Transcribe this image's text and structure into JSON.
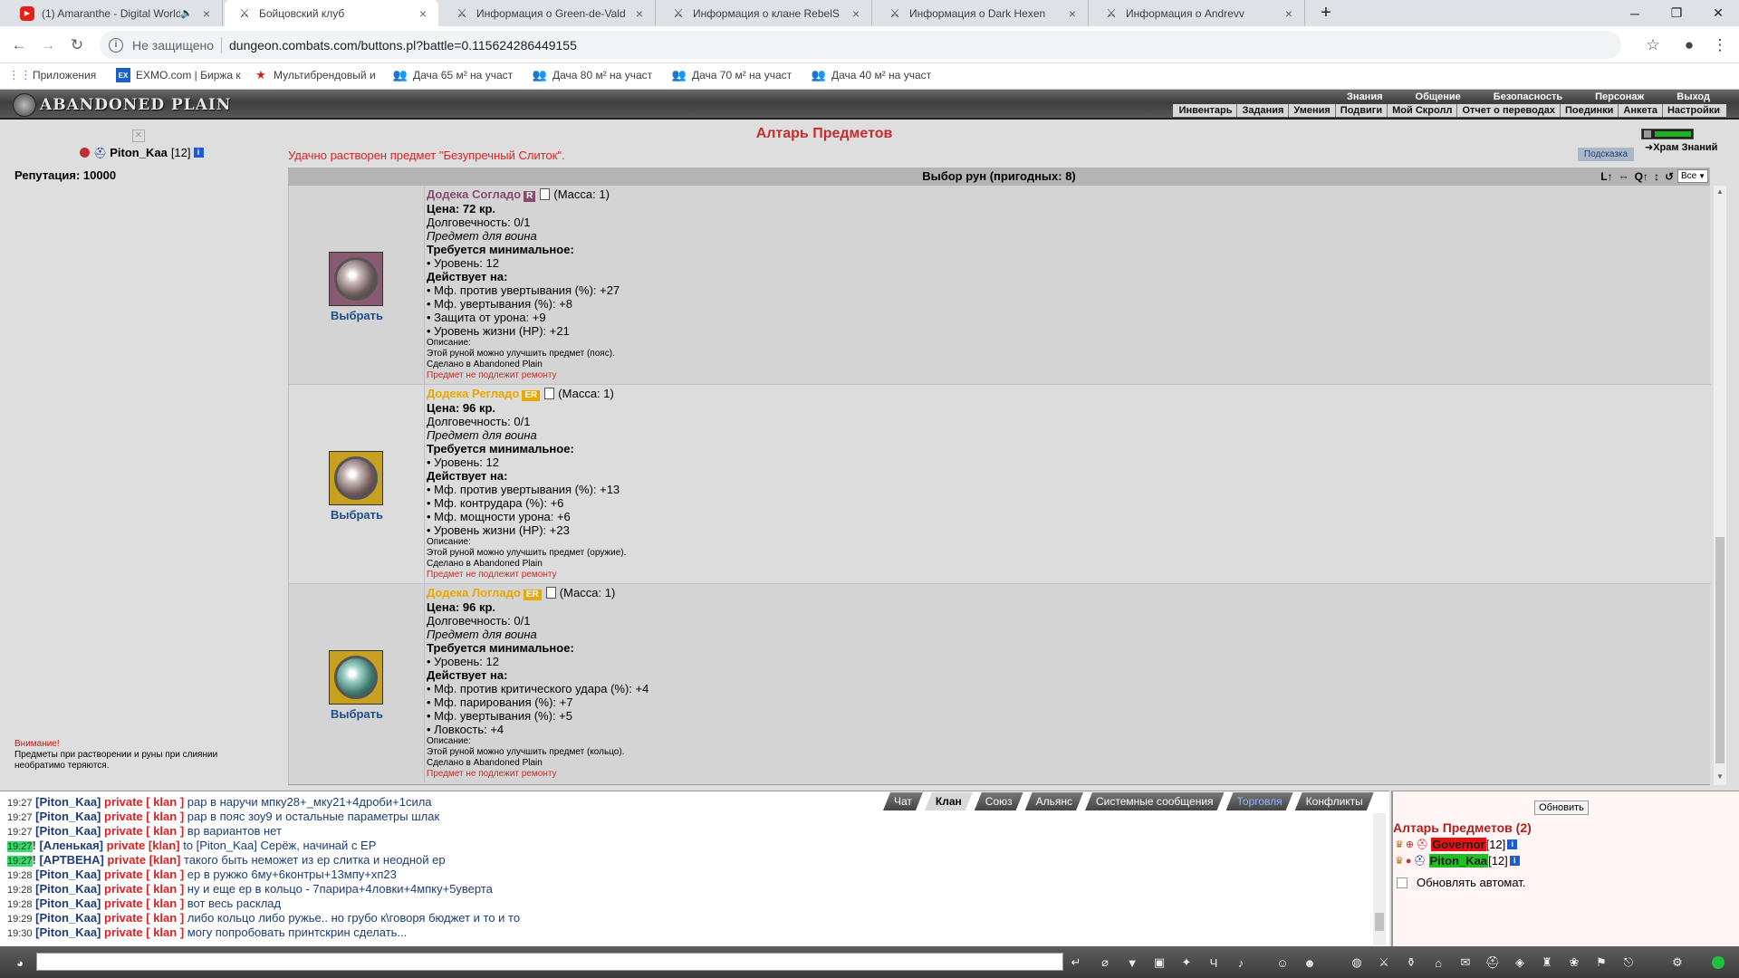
{
  "browser": {
    "tabs": [
      {
        "title": "(1) Amaranthe - Digital World",
        "icon": "youtube-icon",
        "active": false
      },
      {
        "title": "Бойцовский клуб",
        "icon": "swords-icon",
        "active": true
      },
      {
        "title": "Информация о Green-de-Vald",
        "icon": "swords-icon",
        "active": false
      },
      {
        "title": "Информация о клане RebelS",
        "icon": "swords-icon",
        "active": false
      },
      {
        "title": "Информация о Dark Hexen",
        "icon": "swords-icon",
        "active": false
      },
      {
        "title": "Информация о Andrevv",
        "icon": "swords-icon",
        "active": false
      }
    ],
    "security_label": "Не защищено",
    "url": "dungeon.combats.com/buttons.pl?battle=0.115624286449155",
    "bookmarks": [
      {
        "label": "Приложения",
        "icon": "apps-grid-icon"
      },
      {
        "label": "EXMO.com | Биржа к",
        "icon": "exmo-icon"
      },
      {
        "label": "Мультибрендовый и",
        "icon": "star-icon"
      },
      {
        "label": "Дача 65 м² на участ",
        "icon": "people-icon"
      },
      {
        "label": "Дача 80 м² на участ",
        "icon": "people-icon"
      },
      {
        "label": "Дача 70 м² на участ",
        "icon": "people-icon"
      },
      {
        "label": "Дача 40 м² на участ",
        "icon": "people-icon"
      }
    ]
  },
  "game": {
    "logo": "ABANDONED PLAIN",
    "top_menu": [
      "Знания",
      "Общение",
      "Безопасность",
      "Персонаж",
      "Выход"
    ],
    "sub_menu": [
      "Инвентарь",
      "Задания",
      "Умения",
      "Подвиги",
      "Мой Скролл",
      "Отчет о переводах",
      "Поединки",
      "Анкета",
      "Настройки"
    ]
  },
  "player": {
    "name": "Piton_Kaa",
    "level": "[12]",
    "reputation": "Репутация: 10000",
    "warning_title": "Внимание!",
    "warning_text": "Предметы при растворении и руны при слиянии необратимо теряются."
  },
  "main": {
    "title": "Алтарь Предметов",
    "success": "Удачно растворен предмет \"Безупречный Слиток\".",
    "hint_button": "Подсказка",
    "temple_link": "Храм Знаний",
    "list_header": "Выбор рун (пригодных: 8)",
    "filter_value": "Все",
    "sort_icons": [
      "L↑",
      "⇔",
      "Q↑",
      "↕",
      "↺"
    ],
    "pick_label": "Выбрать",
    "items": [
      {
        "name": "Додека Согладо",
        "tag": "R",
        "tag_color": "#8a4a70",
        "name_color": "#8a4a70",
        "mass": "(Масса: 1)",
        "price": "Цена: 72 кр.",
        "durability": "Долговечность: 0/1",
        "for_whom": "Предмет для воина",
        "req_title": "Требуется минимальное:",
        "requirements": [
          "• Уровень: 12"
        ],
        "effects_title": "Действует на:",
        "effects": [
          "• Мф. против увертывания (%): +27",
          "• Мф. увертывания (%): +8",
          "• Защита от урона: +9",
          "• Уровень жизни (HP): +21"
        ],
        "desc_title": "Описание:",
        "desc": "Этой руной можно улучшить предмет (пояс).",
        "made": "Сделано в Abandoned Plain",
        "norepair": "Предмет не подлежит ремонту",
        "rune_color": "#8a5a70"
      },
      {
        "name": "Додека Регладо",
        "tag": "ER",
        "tag_color": "#e8a800",
        "name_color": "#e8a800",
        "mass": "(Масса: 1)",
        "price": "Цена: 96 кр.",
        "durability": "Долговечность: 0/1",
        "for_whom": "Предмет для воина",
        "req_title": "Требуется минимальное:",
        "requirements": [
          "• Уровень: 12"
        ],
        "effects_title": "Действует на:",
        "effects": [
          "• Мф. против увертывания (%): +13",
          "• Мф. контрудара (%): +6",
          "• Мф. мощности урона: +6",
          "• Уровень жизни (HP): +23"
        ],
        "desc_title": "Описание:",
        "desc": "Этой руной можно улучшить предмет (оружие).",
        "made": "Сделано в Abandoned Plain",
        "norepair": "Предмет не подлежит ремонту",
        "rune_color": "#c8a020"
      },
      {
        "name": "Додека Логладо",
        "tag": "ER",
        "tag_color": "#e8a800",
        "name_color": "#e8a800",
        "mass": "(Масса: 1)",
        "price": "Цена: 96 кр.",
        "durability": "Долговечность: 0/1",
        "for_whom": "Предмет для воина",
        "req_title": "Требуется минимальное:",
        "requirements": [
          "• Уровень: 12"
        ],
        "effects_title": "Действует на:",
        "effects": [
          "• Мф. против критического удара (%): +4",
          "• Мф. парирования (%): +7",
          "• Мф. увертывания (%): +5",
          "• Ловкость: +4"
        ],
        "desc_title": "Описание:",
        "desc": "Этой руной можно улучшить предмет (кольцо).",
        "made": "Сделано в Abandoned Plain",
        "norepair": "Предмет не подлежит ремонту",
        "rune_color": "#c8a020"
      }
    ]
  },
  "chat": {
    "tabs": [
      "Чат",
      "Клан",
      "Союз",
      "Альянс",
      "Системные сообщения",
      "Торговля",
      "Конфликты"
    ],
    "lines": [
      {
        "time": "19:27",
        "nick": "[Piton_Kaa]",
        "priv": "private [ klan ]",
        "msg": "рар в наручи мпку28+_мку21+4дроби+1сила",
        "hl": false
      },
      {
        "time": "19:27",
        "nick": "[Piton_Kaa]",
        "priv": "private [ klan ]",
        "msg": "рар в пояс зоу9 и остальные параметры шлак",
        "hl": false
      },
      {
        "time": "19:27",
        "nick": "[Piton_Kaa]",
        "priv": "private [ klan ]",
        "msg": "вр вариантов нет",
        "hl": false
      },
      {
        "time": "19:27",
        "nick": "! [Аленькая]",
        "priv": "private [klan]",
        "msg": "to [Piton_Kaa] Серёж, начинай с ЕР",
        "hl": true
      },
      {
        "time": "19:27",
        "nick": "! [АРТВЕНА]",
        "priv": "private [klan]",
        "msg": "такого быть неможет из ер слитка и неодной ер",
        "hl": true
      },
      {
        "time": "19:28",
        "nick": "[Piton_Kaa]",
        "priv": "private [ klan ]",
        "msg": "ер в ружжо 6му+6контры+13мпу+хп23",
        "hl": false
      },
      {
        "time": "19:28",
        "nick": "[Piton_Kaa]",
        "priv": "private [ klan ]",
        "msg": "ну и еще ер в кольцо - 7парира+4ловки+4мпку+5уверта",
        "hl": false
      },
      {
        "time": "19:28",
        "nick": "[Piton_Kaa]",
        "priv": "private [ klan ]",
        "msg": "вот весь расклад",
        "hl": false
      },
      {
        "time": "19:29",
        "nick": "[Piton_Kaa]",
        "priv": "private [ klan ]",
        "msg": "либо кольцо либо ружье.. но грубо к\\говоря бюджет и то и то",
        "hl": false
      },
      {
        "time": "19:30",
        "nick": "[Piton_Kaa]",
        "priv": "private [ klan ]",
        "msg": "могу попробовать принтскрин сделать...",
        "hl": false
      }
    ]
  },
  "location": {
    "refresh_button": "Обновить",
    "title": "Алтарь Предметов (2)",
    "players": [
      {
        "name": "Governor",
        "level": "[12]",
        "bg": "#e81010"
      },
      {
        "name": "Piton_Kaa",
        "level": "[12]",
        "bg": "#20c020"
      }
    ],
    "autorefresh_label": "Обновлять автомат."
  },
  "colors": {
    "accent_red": "#c62d2d",
    "link_blue": "#1e4d8c"
  }
}
